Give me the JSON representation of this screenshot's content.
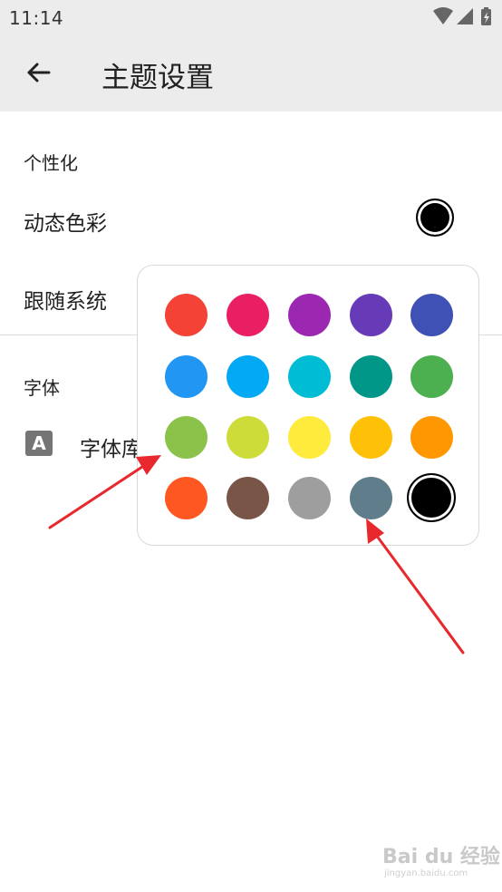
{
  "status_bar": {
    "time": "11:14",
    "icons": [
      "wifi-icon",
      "signal-icon",
      "battery-charging-icon"
    ]
  },
  "app_bar": {
    "title": "主题设置",
    "back_icon": "arrow-back-icon"
  },
  "sections": {
    "personalization": {
      "label": "个性化",
      "dynamic_color_label": "动态色彩",
      "dynamic_color_value": "#000000",
      "follow_system_label": "跟随系统"
    },
    "font": {
      "label": "字体",
      "font_icon_glyph": "A",
      "font_library_label": "字体库"
    }
  },
  "color_picker": {
    "selected_index": 19,
    "colors": [
      "#F44336",
      "#E91E63",
      "#9C27B0",
      "#673AB7",
      "#3F51B5",
      "#2196F3",
      "#03A9F4",
      "#00BCD4",
      "#009688",
      "#4CAF50",
      "#8BC34A",
      "#CDDC39",
      "#FFEB3B",
      "#FFC107",
      "#FF9800",
      "#FF5722",
      "#795548",
      "#9E9E9E",
      "#607D8B",
      "#000000"
    ]
  },
  "annotation_color": "#E8282C",
  "watermark": {
    "text": "Bai du 经验",
    "sub": "jingyan.baidu.com"
  }
}
